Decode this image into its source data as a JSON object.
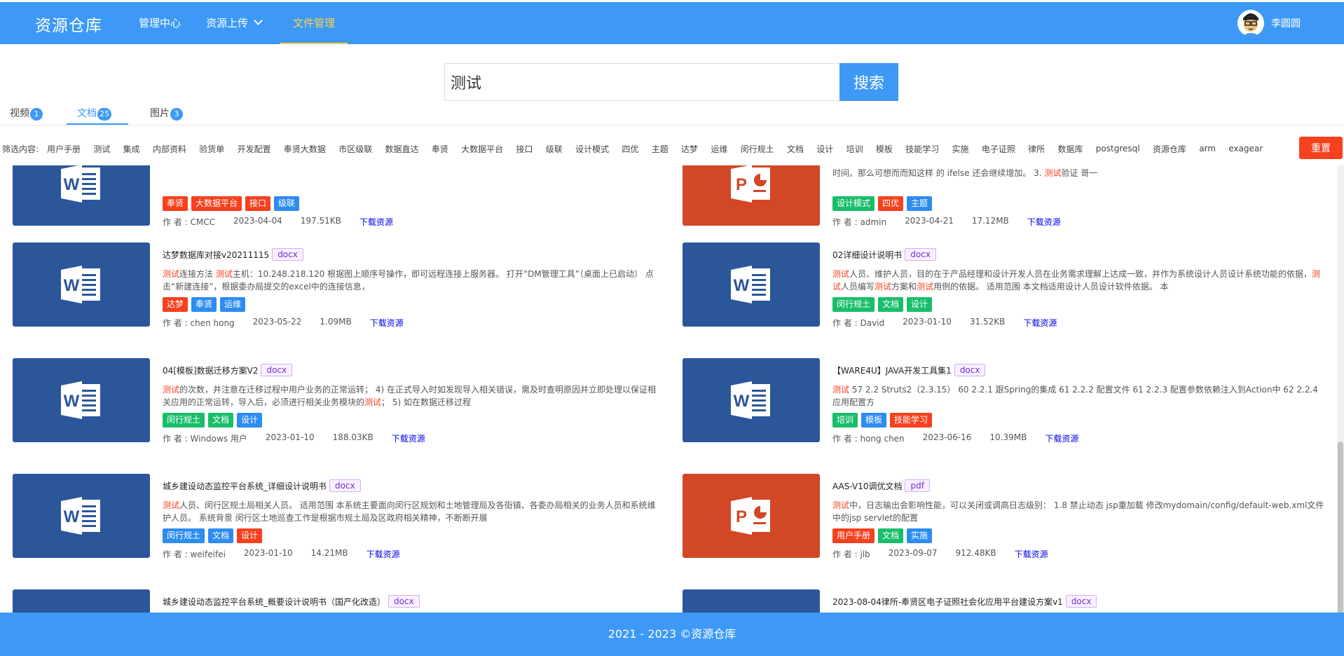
{
  "header": {
    "logo": "资源仓库",
    "nav": [
      {
        "label": "管理中心"
      },
      {
        "label": "资源上传"
      },
      {
        "label": "文件管理"
      }
    ],
    "user_name": "李圆圆"
  },
  "search": {
    "value": "测试",
    "button": "搜索"
  },
  "tabs": [
    {
      "label": "视频",
      "count": "1"
    },
    {
      "label": "文档",
      "count": "25"
    },
    {
      "label": "图片",
      "count": "3"
    }
  ],
  "filter": {
    "label": "筛选内容:",
    "tags": [
      "用户手册",
      "测试",
      "集成",
      "内部资料",
      "验货单",
      "开发配置",
      "奉贤大数据",
      "市区级联",
      "数据直达",
      "奉贤",
      "大数据平台",
      "接口",
      "级联",
      "设计模式",
      "四优",
      "主题",
      "达梦",
      "运维",
      "闵行规土",
      "文档",
      "设计",
      "培训",
      "模板",
      "技能学习",
      "实施",
      "电子证照",
      "律所",
      "数据库",
      "postgresql",
      "资源仓库",
      "arm",
      "exagear"
    ],
    "reset": "重置"
  },
  "colors": {
    "primary": "#3d99f5",
    "active_nav": "#ffd04b",
    "red": "#f5411e",
    "green": "#19be6b",
    "blue": "#2d8cf0",
    "word": "#2b579a",
    "ppt": "#d24726"
  },
  "cards": [
    {
      "type": "word",
      "title": "",
      "ext": "",
      "desc": "",
      "tags": [
        {
          "t": "奉贤",
          "c": "red"
        },
        {
          "t": "大数据平台",
          "c": "red"
        },
        {
          "t": "接口",
          "c": "red"
        },
        {
          "t": "级联",
          "c": "blue"
        }
      ],
      "author": "作 者 : CMCC",
      "date": "2023-04-04",
      "size": "197.51KB",
      "download": "下载资源"
    },
    {
      "type": "ppt",
      "title": "",
      "ext": "",
      "desc": "时间。那么可想而而知这样 的 ifelse 还会继续增加。 3. |测试|验证 哥一",
      "tags": [
        {
          "t": "设计模式",
          "c": "green"
        },
        {
          "t": "四优",
          "c": "red"
        },
        {
          "t": "主题",
          "c": "blue"
        }
      ],
      "author": "作 者 : admin",
      "date": "2023-04-21",
      "size": "17.12MB",
      "download": "下载资源"
    },
    {
      "type": "word",
      "title": "达梦数据库对接v20211115",
      "ext": "docx",
      "desc": "|测试|连接方法 |测试|主机：10.248.218.120 根据图上顺序号操作，即可远程连接上服务器。 打开“DM管理工具”（桌面上已启动） 点击“新建连接”，根据委办局提交的excel中的连接信息，",
      "tags": [
        {
          "t": "达梦",
          "c": "red"
        },
        {
          "t": "奉贤",
          "c": "blue"
        },
        {
          "t": "运维",
          "c": "blue"
        }
      ],
      "author": "作 者 : chen hong",
      "date": "2023-05-22",
      "size": "1.09MB",
      "download": "下载资源"
    },
    {
      "type": "word",
      "title": "02详细设计说明书",
      "ext": "docx",
      "desc": "|测试|人员、维护人员，目的在于产品经理和设计开发人员在业务需求理解上达成一致，并作为系统设计人员设计系统功能的依据，|测试|人员编写|测试|方案和|测试|用例的依据。 适用范围 本文档适用设计人员设计软件依据。 本",
      "tags": [
        {
          "t": "闵行规土",
          "c": "green"
        },
        {
          "t": "文档",
          "c": "green"
        },
        {
          "t": "设计",
          "c": "green"
        }
      ],
      "author": "作 者 : David",
      "date": "2023-01-10",
      "size": "31.52KB",
      "download": "下载资源"
    },
    {
      "type": "word",
      "title": "04[模板]数据迁移方案V2",
      "ext": "docx",
      "desc": "|测试|的次数，并注意在迁移过程中用户业务的正常运转； 4) 在正式导入时如发现导入相关错误，需及时查明原因并立即处理以保证相关应用的正常运转，导入后，必须进行相关业务模块的|测试|； 5) 如在数据迁移过程",
      "tags": [
        {
          "t": "闵行规土",
          "c": "green"
        },
        {
          "t": "文档",
          "c": "green"
        },
        {
          "t": "设计",
          "c": "blue"
        }
      ],
      "author": "作 者 : Windows 用户",
      "date": "2023-01-10",
      "size": "188.03KB",
      "download": "下载资源"
    },
    {
      "type": "word",
      "title": "【WARE4U】JAVA开发工具集1",
      "ext": "docx",
      "desc": "|测试| 57 2.2 Struts2（2.3.15） 60 2.2.1 跟Spring的集成 61 2.2.2 配置文件 61 2.2.3 配置参数依赖注入到Action中 62 2.2.4 应用配置方",
      "tags": [
        {
          "t": "培训",
          "c": "green"
        },
        {
          "t": "模板",
          "c": "blue"
        },
        {
          "t": "技能学习",
          "c": "red"
        }
      ],
      "author": "作 者 : hong chen",
      "date": "2023-06-16",
      "size": "10.39MB",
      "download": "下载资源"
    },
    {
      "type": "word",
      "title": "城乡建设动态监控平台系统_详细设计说明书",
      "ext": "docx",
      "desc": "|测试|人员、闵行区规土局相关人员。 适用范围 本系统主要面向闵行区规划和土地管理局及各街镇、各委办局相关的业务人员和系统维护人员。 系统背景 闵行区土地巡查工作是根据市规土局及区政府相关精神，不断断开展",
      "tags": [
        {
          "t": "闵行规土",
          "c": "blue"
        },
        {
          "t": "文档",
          "c": "blue"
        },
        {
          "t": "设计",
          "c": "red"
        }
      ],
      "author": "作 者 : weifeifei",
      "date": "2023-01-10",
      "size": "14.21MB",
      "download": "下载资源"
    },
    {
      "type": "ppt",
      "title": "AAS-V10调优文档",
      "ext": "pdf",
      "desc": "|测试|中，日志输出会影响性能，可以关闭或调高日志级别： 1.8 禁止动态 jsp重加载 修改mydomain/config/default-web.xml文件中的jsp servlet的配置",
      "tags": [
        {
          "t": "用户手册",
          "c": "red"
        },
        {
          "t": "文档",
          "c": "green"
        },
        {
          "t": "实施",
          "c": "blue"
        }
      ],
      "author": "作 者 : jlb",
      "date": "2023-09-07",
      "size": "912.48KB",
      "download": "下载资源"
    },
    {
      "type": "word",
      "title": "城乡建设动态监控平台系统_概要设计说明书（国产化改造）",
      "ext": "docx",
      "desc": "",
      "tags": [],
      "author": "",
      "date": "",
      "size": "",
      "download": ""
    },
    {
      "type": "word",
      "title": "2023-08-04律所-奉贤区电子证照社会化应用平台建设方案v1",
      "ext": "docx",
      "desc": "",
      "tags": [],
      "author": "",
      "date": "",
      "size": "",
      "download": ""
    }
  ],
  "footer": "2021 - 2023 ©资源仓库"
}
